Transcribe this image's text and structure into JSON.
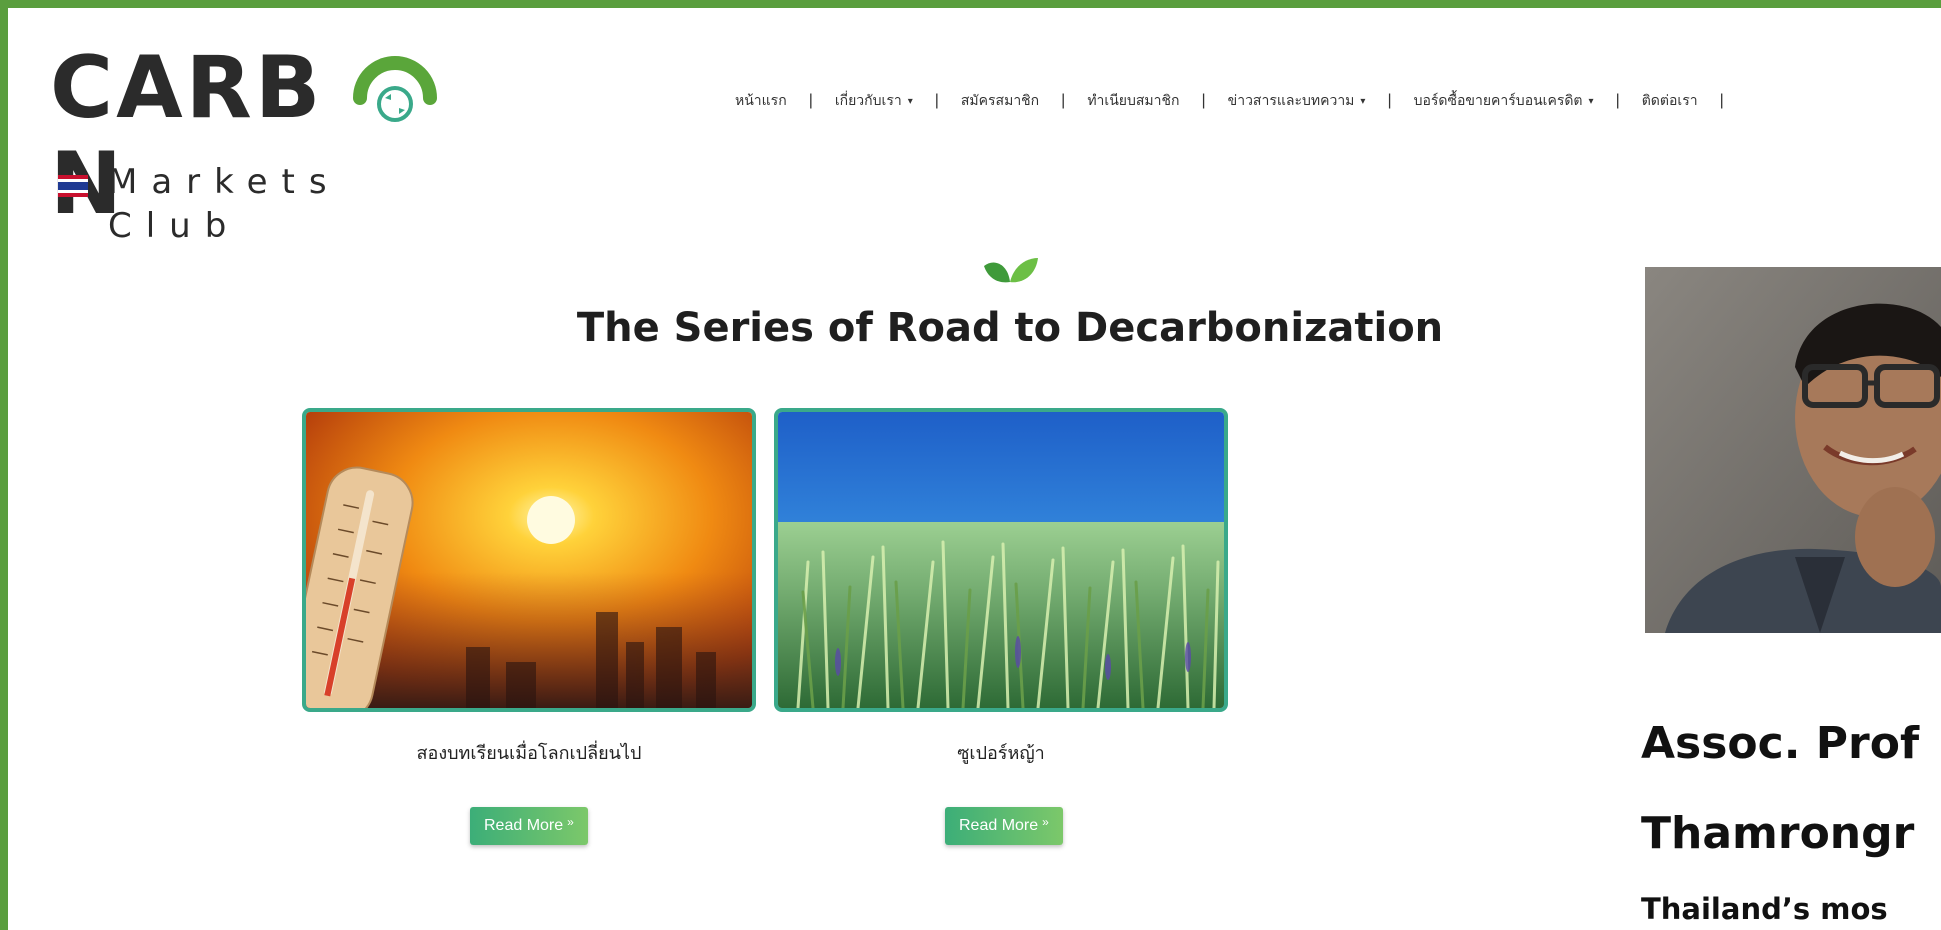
{
  "logo": {
    "word_start": "CARB",
    "word_end": "N",
    "subtitle": "Markets Club",
    "flag_colors": [
      "#c8102e",
      "#ffffff",
      "#1f3a93"
    ],
    "accent": "#5aa63a"
  },
  "nav": {
    "items": [
      {
        "label": "หน้าแรก",
        "dropdown": false
      },
      {
        "label": "เกี่ยวกับเรา",
        "dropdown": true
      },
      {
        "label": "สมัครสมาชิก",
        "dropdown": false
      },
      {
        "label": "ทำเนียบสมาชิก",
        "dropdown": false
      },
      {
        "label": "ข่าวสารและบทความ",
        "dropdown": true
      },
      {
        "label": "บอร์ดซื้อขายคาร์บอนเครดิต",
        "dropdown": true
      },
      {
        "label": "ติดต่อเรา",
        "dropdown": false
      }
    ],
    "separator": "|",
    "caret": "▾"
  },
  "section": {
    "title": "The Series of Road to Decarbonization",
    "cards": [
      {
        "title": "สองบทเรียนเมื่อโลกเปลี่ยนไป",
        "button": "Read More",
        "image_icon": "thermometer-sunset-image"
      },
      {
        "title": "ซูเปอร์หญ้า",
        "button": "Read More",
        "image_icon": "seagrass-underwater-image"
      }
    ],
    "button_chevron": "»"
  },
  "profile": {
    "name_line1": "Assoc. Prof",
    "name_line2": "Thamrongr",
    "tagline": "Thailand’s mos"
  },
  "colors": {
    "frame": "#5a9e3e",
    "card_border": "#3aa98a",
    "button_start": "#3cae78",
    "button_end": "#7cc86a"
  }
}
